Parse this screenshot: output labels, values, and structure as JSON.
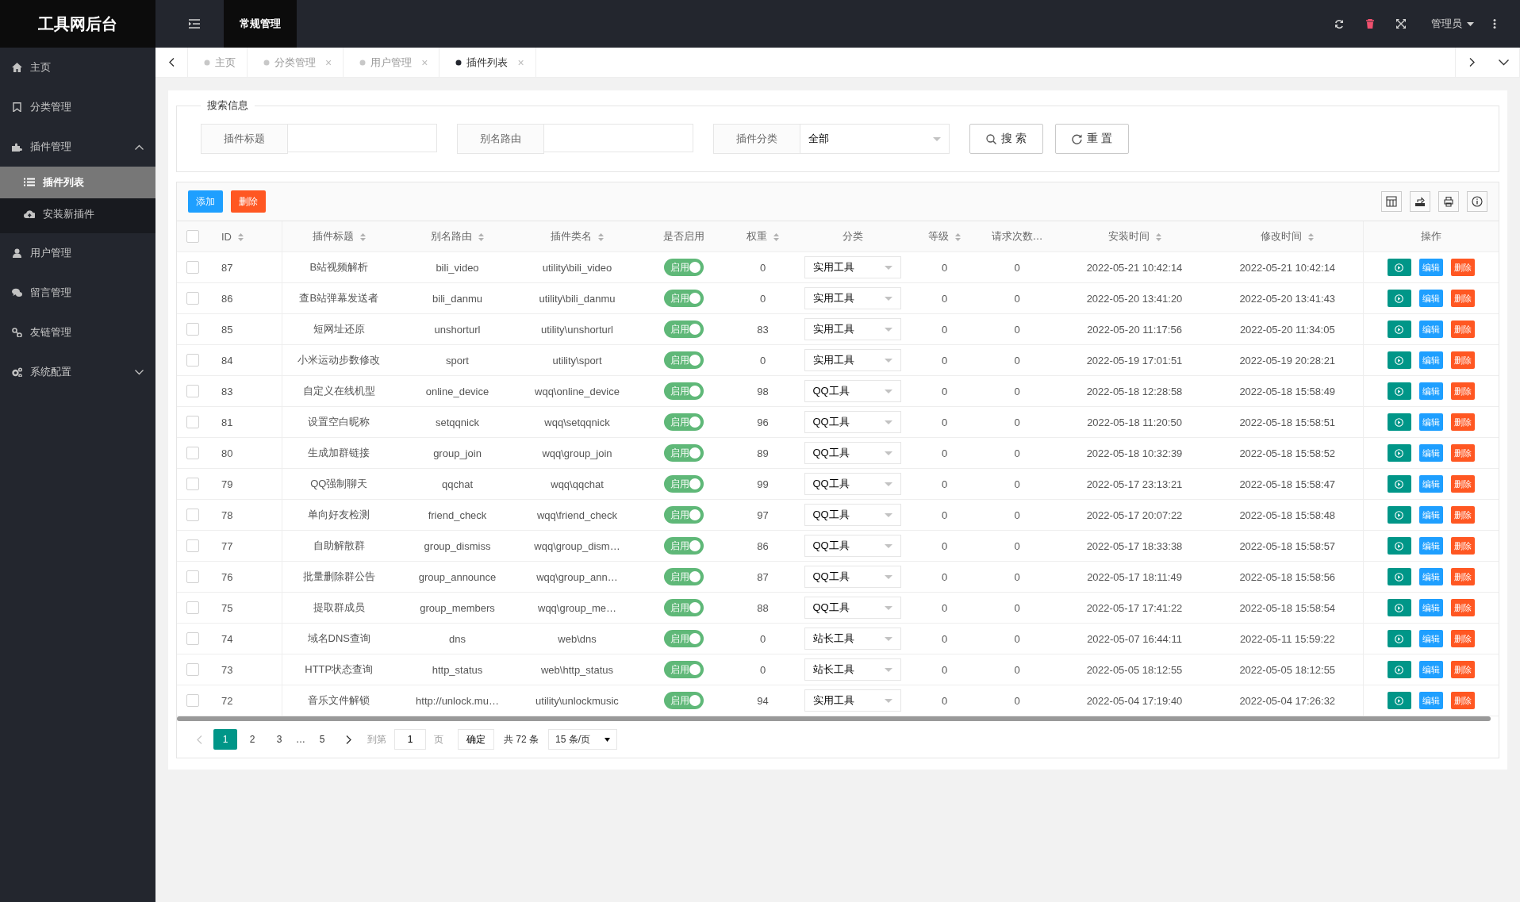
{
  "brand": "工具网后台",
  "topbar": {
    "tabs": [
      {
        "label": "常规管理",
        "selected": true
      }
    ],
    "user": "管理员"
  },
  "sidebar": {
    "items": [
      {
        "label": "主页"
      },
      {
        "label": "分类管理"
      },
      {
        "label": "插件管理",
        "expanded": true,
        "children": [
          {
            "label": "插件列表",
            "selected": true
          },
          {
            "label": "安装新插件",
            "selected": false
          }
        ]
      },
      {
        "label": "用户管理"
      },
      {
        "label": "留言管理"
      },
      {
        "label": "友链管理"
      },
      {
        "label": "系统配置",
        "expanded": false
      }
    ]
  },
  "page_tabs": [
    {
      "label": "主页",
      "selected": false
    },
    {
      "label": "分类管理",
      "close": "×",
      "selected": false
    },
    {
      "label": "用户管理",
      "close": "×",
      "selected": false
    },
    {
      "label": "插件列表",
      "close": "×",
      "selected": true
    }
  ],
  "search": {
    "title": "搜索信息",
    "fields": [
      {
        "kind": "text",
        "label": "插件标题"
      },
      {
        "kind": "text",
        "label": "别名路由"
      },
      {
        "kind": "select",
        "label": "插件分类",
        "value": "全部"
      }
    ],
    "buttons": [
      {
        "kind": "search",
        "label": "搜 索"
      },
      {
        "kind": "reset",
        "label": "重 置"
      }
    ]
  },
  "toolbar": {
    "buttons": [
      {
        "kind": "add",
        "label": "添加"
      },
      {
        "kind": "delete",
        "label": "删除"
      }
    ]
  },
  "table": {
    "select_all": {
      "checked": false
    },
    "columns": [
      {
        "label": "ID",
        "sortable": true
      },
      {
        "label": "插件标题",
        "sortable": true
      },
      {
        "label": "别名路由",
        "sortable": true
      },
      {
        "label": "插件类名",
        "sortable": true
      },
      {
        "label": "是否启用",
        "sortable": false
      },
      {
        "label": "权重",
        "sortable": true
      },
      {
        "label": "分类",
        "sortable": false
      },
      {
        "label": "等级",
        "sortable": true
      },
      {
        "label": "请求次数…",
        "sortable": false
      },
      {
        "label": "安装时间",
        "sortable": true
      },
      {
        "label": "修改时间",
        "sortable": true
      },
      {
        "label": "操作",
        "sortable": false
      }
    ],
    "rows": [
      {
        "checked": false,
        "id": "87",
        "title": "B站视频解析",
        "alias": "bili_video",
        "class": "utility\\bili_video",
        "on": true,
        "switch": "启用",
        "weight": "0",
        "category": "实用工具",
        "level": "0",
        "requests": "0",
        "installed": "2022-05-21 10:42:14",
        "modified": "2022-05-21 10:42:14",
        "edit": "编辑",
        "delete": "删除"
      },
      {
        "checked": false,
        "id": "86",
        "title": "查B站弹幕发送者",
        "alias": "bili_danmu",
        "class": "utility\\bili_danmu",
        "on": true,
        "switch": "启用",
        "weight": "0",
        "category": "实用工具",
        "level": "0",
        "requests": "0",
        "installed": "2022-05-20 13:41:20",
        "modified": "2022-05-20 13:41:43",
        "edit": "编辑",
        "delete": "删除"
      },
      {
        "checked": false,
        "id": "85",
        "title": "短网址还原",
        "alias": "unshorturl",
        "class": "utility\\unshorturl",
        "on": true,
        "switch": "启用",
        "weight": "83",
        "category": "实用工具",
        "level": "0",
        "requests": "0",
        "installed": "2022-05-20 11:17:56",
        "modified": "2022-05-20 11:34:05",
        "edit": "编辑",
        "delete": "删除"
      },
      {
        "checked": false,
        "id": "84",
        "title": "小米运动步数修改",
        "alias": "sport",
        "class": "utility\\sport",
        "on": true,
        "switch": "启用",
        "weight": "0",
        "category": "实用工具",
        "level": "0",
        "requests": "0",
        "installed": "2022-05-19 17:01:51",
        "modified": "2022-05-19 20:28:21",
        "edit": "编辑",
        "delete": "删除"
      },
      {
        "checked": false,
        "id": "83",
        "title": "自定义在线机型",
        "alias": "online_device",
        "class": "wqq\\online_device",
        "on": true,
        "switch": "启用",
        "weight": "98",
        "category": "QQ工具",
        "level": "0",
        "requests": "0",
        "installed": "2022-05-18 12:28:58",
        "modified": "2022-05-18 15:58:49",
        "edit": "编辑",
        "delete": "删除"
      },
      {
        "checked": false,
        "id": "81",
        "title": "设置空白昵称",
        "alias": "setqqnick",
        "class": "wqq\\setqqnick",
        "on": true,
        "switch": "启用",
        "weight": "96",
        "category": "QQ工具",
        "level": "0",
        "requests": "0",
        "installed": "2022-05-18 11:20:50",
        "modified": "2022-05-18 15:58:51",
        "edit": "编辑",
        "delete": "删除"
      },
      {
        "checked": false,
        "id": "80",
        "title": "生成加群链接",
        "alias": "group_join",
        "class": "wqq\\group_join",
        "on": true,
        "switch": "启用",
        "weight": "89",
        "category": "QQ工具",
        "level": "0",
        "requests": "0",
        "installed": "2022-05-18 10:32:39",
        "modified": "2022-05-18 15:58:52",
        "edit": "编辑",
        "delete": "删除"
      },
      {
        "checked": false,
        "id": "79",
        "title": "QQ强制聊天",
        "alias": "qqchat",
        "class": "wqq\\qqchat",
        "on": true,
        "switch": "启用",
        "weight": "99",
        "category": "QQ工具",
        "level": "0",
        "requests": "0",
        "installed": "2022-05-17 23:13:21",
        "modified": "2022-05-18 15:58:47",
        "edit": "编辑",
        "delete": "删除"
      },
      {
        "checked": false,
        "id": "78",
        "title": "单向好友检测",
        "alias": "friend_check",
        "class": "wqq\\friend_check",
        "on": true,
        "switch": "启用",
        "weight": "97",
        "category": "QQ工具",
        "level": "0",
        "requests": "0",
        "installed": "2022-05-17 20:07:22",
        "modified": "2022-05-18 15:58:48",
        "edit": "编辑",
        "delete": "删除"
      },
      {
        "checked": false,
        "id": "77",
        "title": "自助解散群",
        "alias": "group_dismiss",
        "class": "wqq\\group_dism…",
        "on": true,
        "switch": "启用",
        "weight": "86",
        "category": "QQ工具",
        "level": "0",
        "requests": "0",
        "installed": "2022-05-17 18:33:38",
        "modified": "2022-05-18 15:58:57",
        "edit": "编辑",
        "delete": "删除"
      },
      {
        "checked": false,
        "id": "76",
        "title": "批量删除群公告",
        "alias": "group_announce",
        "class": "wqq\\group_ann…",
        "on": true,
        "switch": "启用",
        "weight": "87",
        "category": "QQ工具",
        "level": "0",
        "requests": "0",
        "installed": "2022-05-17 18:11:49",
        "modified": "2022-05-18 15:58:56",
        "edit": "编辑",
        "delete": "删除"
      },
      {
        "checked": false,
        "id": "75",
        "title": "提取群成员",
        "alias": "group_members",
        "class": "wqq\\group_me…",
        "on": true,
        "switch": "启用",
        "weight": "88",
        "category": "QQ工具",
        "level": "0",
        "requests": "0",
        "installed": "2022-05-17 17:41:22",
        "modified": "2022-05-18 15:58:54",
        "edit": "编辑",
        "delete": "删除"
      },
      {
        "checked": false,
        "id": "74",
        "title": "域名DNS查询",
        "alias": "dns",
        "class": "web\\dns",
        "on": true,
        "switch": "启用",
        "weight": "0",
        "category": "站长工具",
        "level": "0",
        "requests": "0",
        "installed": "2022-05-07 16:44:11",
        "modified": "2022-05-11 15:59:22",
        "edit": "编辑",
        "delete": "删除"
      },
      {
        "checked": false,
        "id": "73",
        "title": "HTTP状态查询",
        "alias": "http_status",
        "class": "web\\http_status",
        "on": true,
        "switch": "启用",
        "weight": "0",
        "category": "站长工具",
        "level": "0",
        "requests": "0",
        "installed": "2022-05-05 18:12:55",
        "modified": "2022-05-05 18:12:55",
        "edit": "编辑",
        "delete": "删除"
      },
      {
        "checked": false,
        "id": "72",
        "title": "音乐文件解锁",
        "alias": "http://unlock.mu…",
        "class": "utility\\unlockmusic",
        "on": true,
        "switch": "启用",
        "weight": "94",
        "category": "实用工具",
        "level": "0",
        "requests": "0",
        "installed": "2022-05-04 17:19:40",
        "modified": "2022-05-04 17:26:32",
        "edit": "编辑",
        "delete": "删除"
      }
    ]
  },
  "pagination": {
    "prev": {
      "disabled": true
    },
    "pages": [
      {
        "kind": "page",
        "label": "1",
        "selected": true
      },
      {
        "kind": "page",
        "label": "2",
        "selected": false
      },
      {
        "kind": "page",
        "label": "3",
        "selected": false
      },
      {
        "kind": "ellipsis",
        "label": "…"
      },
      {
        "kind": "page",
        "label": "5",
        "selected": false
      }
    ],
    "next": {
      "disabled": false
    },
    "goto_label": "到第",
    "goto_value": "1",
    "page_unit": "页",
    "confirm": "确定",
    "total": "共 72 条",
    "page_size": "15 条/页"
  }
}
